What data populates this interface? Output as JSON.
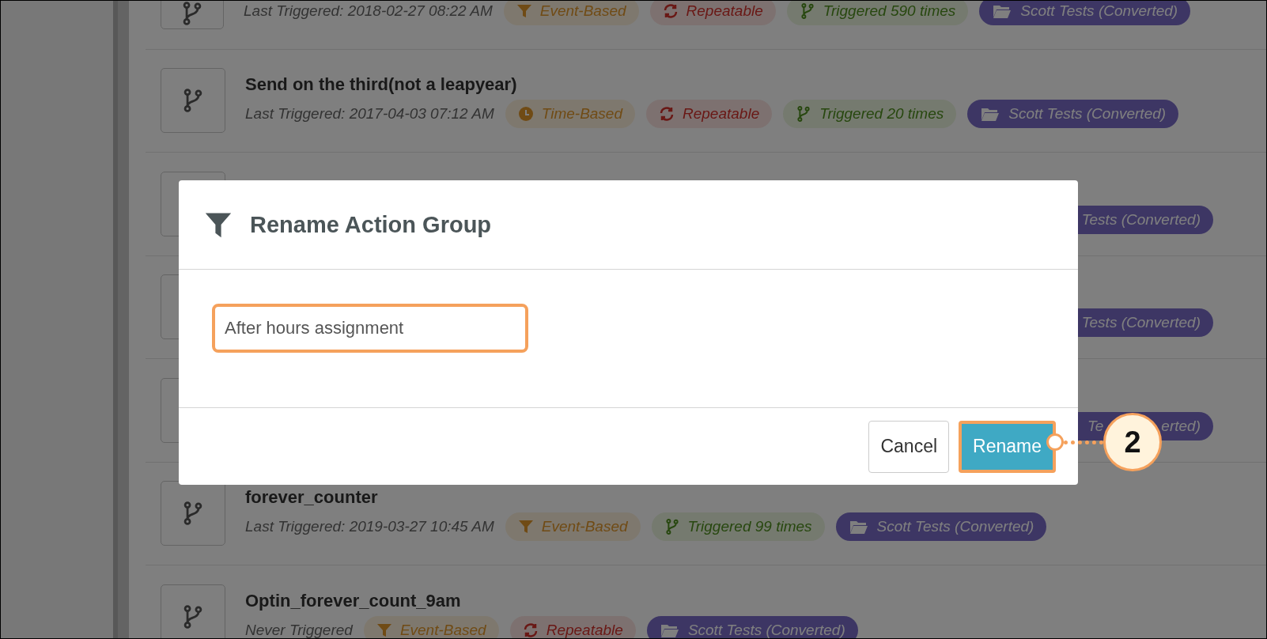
{
  "rows": [
    {
      "kind": "full",
      "meta": "Last Triggered: 2018-02-27 08:22 AM",
      "tags": [
        {
          "kind": "event",
          "text": "Event-Based"
        },
        {
          "kind": "repeat",
          "text": "Repeatable"
        },
        {
          "kind": "triggered",
          "text": "Triggered 590 times"
        },
        {
          "kind": "folder",
          "text": "Scott Tests (Converted)"
        }
      ]
    },
    {
      "kind": "full",
      "title": "Send on the third(not a leapyear)",
      "meta": "Last Triggered: 2017-04-03 07:12 AM",
      "tags": [
        {
          "kind": "time",
          "text": "Time-Based"
        },
        {
          "kind": "repeat",
          "text": "Repeatable"
        },
        {
          "kind": "triggered",
          "text": "Triggered 20 times"
        },
        {
          "kind": "folder",
          "text": "Scott Tests (Converted)"
        }
      ]
    },
    {
      "kind": "covered",
      "tags": [
        {
          "kind": "folder",
          "text": "Tests (Converted)"
        }
      ]
    },
    {
      "kind": "covered",
      "tags": [
        {
          "kind": "folder",
          "text": "Tests (Converted)"
        }
      ]
    },
    {
      "kind": "covered",
      "tags": [
        {
          "kind": "folder",
          "parts": [
            "Te",
            "erted)"
          ]
        }
      ]
    },
    {
      "kind": "full",
      "title": "forever_counter",
      "meta": "Last Triggered: 2019-03-27 10:45 AM",
      "tags": [
        {
          "kind": "event",
          "text": "Event-Based"
        },
        {
          "kind": "triggered",
          "text": "Triggered 99 times"
        },
        {
          "kind": "folder",
          "text": "Scott Tests (Converted)"
        }
      ]
    },
    {
      "kind": "full",
      "title": "Optin_forever_count_9am",
      "meta": "Never Triggered",
      "tags": [
        {
          "kind": "event",
          "text": "Event-Based"
        },
        {
          "kind": "repeat",
          "text": "Repeatable"
        },
        {
          "kind": "folder",
          "text": "Scott Tests (Converted)"
        }
      ]
    }
  ],
  "modal": {
    "title": "Rename Action Group",
    "input_value": "After hours assignment",
    "buttons": [
      {
        "label": "Cancel",
        "primary": false,
        "highlighted": false
      },
      {
        "label": "Rename",
        "primary": true,
        "highlighted": true
      }
    ],
    "callout": "2"
  }
}
